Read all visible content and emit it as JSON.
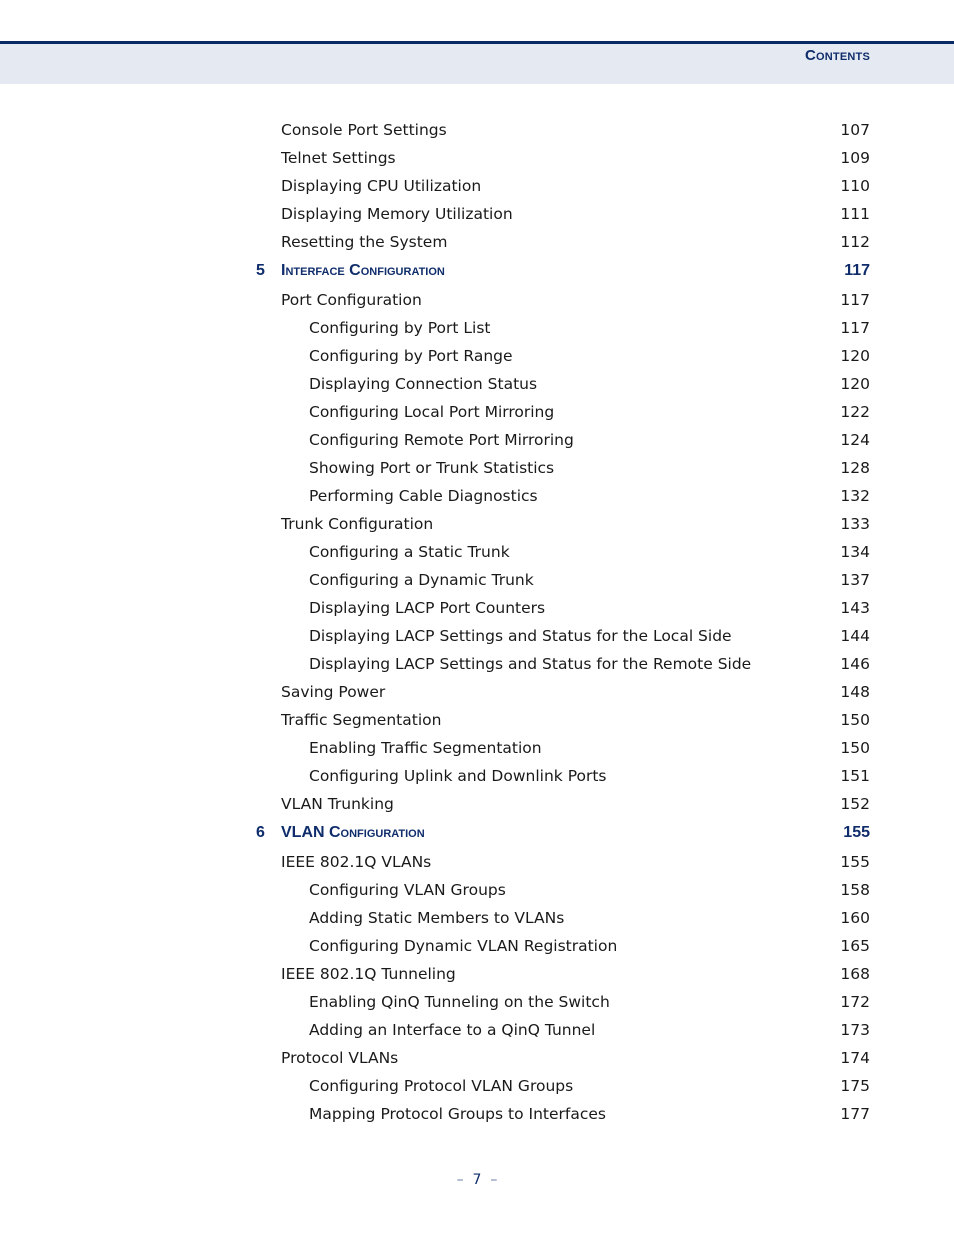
{
  "header": {
    "title": "Contents"
  },
  "toc": [
    {
      "level": 1,
      "label": "Console Port Settings",
      "page": "107"
    },
    {
      "level": 1,
      "label": "Telnet Settings",
      "page": "109"
    },
    {
      "level": 1,
      "label": "Displaying CPU Utilization",
      "page": "110"
    },
    {
      "level": 1,
      "label": "Displaying Memory Utilization",
      "page": "111"
    },
    {
      "level": 1,
      "label": "Resetting the System",
      "page": "112"
    },
    {
      "level": 0,
      "num": "5",
      "label": "Interface Configuration",
      "page": "117"
    },
    {
      "level": 1,
      "label": "Port Configuration",
      "page": "117"
    },
    {
      "level": 2,
      "label": "Configuring by Port List",
      "page": "117"
    },
    {
      "level": 2,
      "label": "Configuring by Port Range",
      "page": "120"
    },
    {
      "level": 2,
      "label": "Displaying Connection Status",
      "page": "120"
    },
    {
      "level": 2,
      "label": "Configuring Local Port Mirroring",
      "page": "122"
    },
    {
      "level": 2,
      "label": "Configuring Remote Port Mirroring",
      "page": "124"
    },
    {
      "level": 2,
      "label": "Showing Port or Trunk Statistics",
      "page": "128"
    },
    {
      "level": 2,
      "label": "Performing Cable Diagnostics",
      "page": "132"
    },
    {
      "level": 1,
      "label": "Trunk Configuration",
      "page": "133"
    },
    {
      "level": 2,
      "label": "Configuring a Static Trunk",
      "page": "134"
    },
    {
      "level": 2,
      "label": "Configuring a Dynamic Trunk",
      "page": "137"
    },
    {
      "level": 2,
      "label": "Displaying LACP Port Counters",
      "page": "143"
    },
    {
      "level": 2,
      "label": "Displaying LACP Settings and Status for the Local Side",
      "page": "144"
    },
    {
      "level": 2,
      "label": "Displaying LACP Settings and Status for the Remote Side",
      "page": "146"
    },
    {
      "level": 1,
      "label": "Saving Power",
      "page": "148"
    },
    {
      "level": 1,
      "label": "Traffic Segmentation",
      "page": "150"
    },
    {
      "level": 2,
      "label": "Enabling Traffic Segmentation",
      "page": "150"
    },
    {
      "level": 2,
      "label": "Configuring Uplink and Downlink Ports",
      "page": "151"
    },
    {
      "level": 1,
      "label": "VLAN Trunking",
      "page": "152"
    },
    {
      "level": 0,
      "num": "6",
      "label": "VLAN Configuration",
      "page": "155"
    },
    {
      "level": 1,
      "label": "IEEE 802.1Q VLANs",
      "page": "155"
    },
    {
      "level": 2,
      "label": "Configuring VLAN Groups",
      "page": "158"
    },
    {
      "level": 2,
      "label": "Adding Static Members to VLANs",
      "page": "160"
    },
    {
      "level": 2,
      "label": "Configuring Dynamic VLAN Registration",
      "page": "165"
    },
    {
      "level": 1,
      "label": "IEEE 802.1Q Tunneling",
      "page": "168"
    },
    {
      "level": 2,
      "label": "Enabling QinQ Tunneling on the Switch",
      "page": "172"
    },
    {
      "level": 2,
      "label": "Adding an Interface to a QinQ Tunnel",
      "page": "173"
    },
    {
      "level": 1,
      "label": "Protocol VLANs",
      "page": "174"
    },
    {
      "level": 2,
      "label": "Configuring Protocol VLAN Groups",
      "page": "175"
    },
    {
      "level": 2,
      "label": "Mapping Protocol Groups to Interfaces",
      "page": "177"
    }
  ],
  "footer": {
    "page_number": "7",
    "dash": "–"
  }
}
